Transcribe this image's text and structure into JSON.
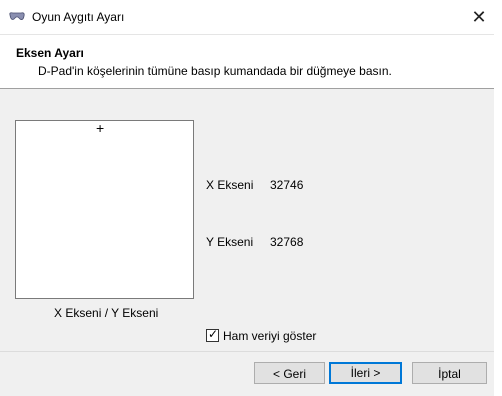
{
  "window": {
    "title": "Oyun Aygıtı Ayarı",
    "close_glyph": "✕"
  },
  "header": {
    "title": "Eksen Ayarı",
    "subtitle": "D-Pad'in köşelerinin tümüne basıp kumandada bir düğmeye basın."
  },
  "crosshair": {
    "glyph": "+",
    "caption": "X Ekseni / Y Ekseni"
  },
  "axes": [
    {
      "name": "X Ekseni",
      "value": "32746"
    },
    {
      "name": "Y Ekseni",
      "value": "32768"
    }
  ],
  "raw_data": {
    "label": "Ham veriyi göster",
    "checked": true,
    "check_glyph": "✓"
  },
  "buttons": {
    "back": "< Geri",
    "next": "İleri >",
    "cancel": "İptal"
  },
  "colors": {
    "accent": "#0078d7"
  }
}
